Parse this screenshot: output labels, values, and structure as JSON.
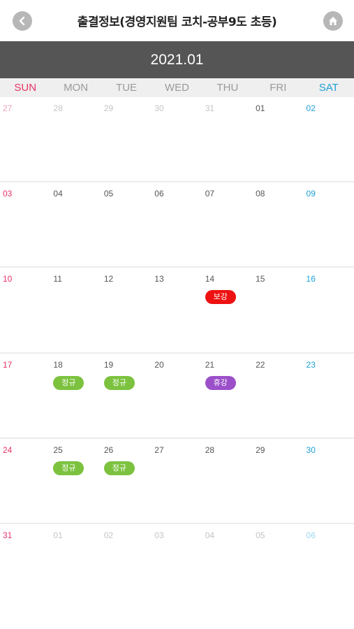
{
  "header": {
    "title": "출결정보(경영지원팀 코치-공부9도 초등)",
    "back_icon": "chevron-left-icon",
    "home_icon": "home-icon"
  },
  "calendar": {
    "month": "2021.01",
    "weekdays": [
      "SUN",
      "MON",
      "TUE",
      "WED",
      "THU",
      "FRI",
      "SAT"
    ],
    "weeks": [
      [
        {
          "d": "27",
          "other": true
        },
        {
          "d": "28",
          "other": true
        },
        {
          "d": "29",
          "other": true
        },
        {
          "d": "30",
          "other": true
        },
        {
          "d": "31",
          "other": true
        },
        {
          "d": "01"
        },
        {
          "d": "02"
        }
      ],
      [
        {
          "d": "03"
        },
        {
          "d": "04"
        },
        {
          "d": "05"
        },
        {
          "d": "06"
        },
        {
          "d": "07"
        },
        {
          "d": "08"
        },
        {
          "d": "09"
        }
      ],
      [
        {
          "d": "10"
        },
        {
          "d": "11"
        },
        {
          "d": "12"
        },
        {
          "d": "13"
        },
        {
          "d": "14",
          "badge": "보강",
          "type": "bogang"
        },
        {
          "d": "15"
        },
        {
          "d": "16"
        }
      ],
      [
        {
          "d": "17"
        },
        {
          "d": "18",
          "badge": "정규",
          "type": "jeonggyu"
        },
        {
          "d": "19",
          "badge": "정규",
          "type": "jeonggyu"
        },
        {
          "d": "20"
        },
        {
          "d": "21",
          "badge": "휴강",
          "type": "hyugang"
        },
        {
          "d": "22"
        },
        {
          "d": "23"
        }
      ],
      [
        {
          "d": "24"
        },
        {
          "d": "25",
          "badge": "정규",
          "type": "jeonggyu"
        },
        {
          "d": "26",
          "badge": "정규",
          "type": "jeonggyu"
        },
        {
          "d": "27"
        },
        {
          "d": "28"
        },
        {
          "d": "29"
        },
        {
          "d": "30"
        }
      ],
      [
        {
          "d": "31"
        },
        {
          "d": "01",
          "other": true
        },
        {
          "d": "02",
          "other": true
        },
        {
          "d": "03",
          "other": true
        },
        {
          "d": "04",
          "other": true
        },
        {
          "d": "05",
          "other": true
        },
        {
          "d": "06",
          "other": true
        }
      ]
    ]
  },
  "colors": {
    "sunday": "#e63366",
    "saturday": "#1ea0d6",
    "month_bar": "#555555",
    "bogang": "#ee1111",
    "jeonggyu": "#7cc23f",
    "hyugang": "#9b4fc9"
  }
}
